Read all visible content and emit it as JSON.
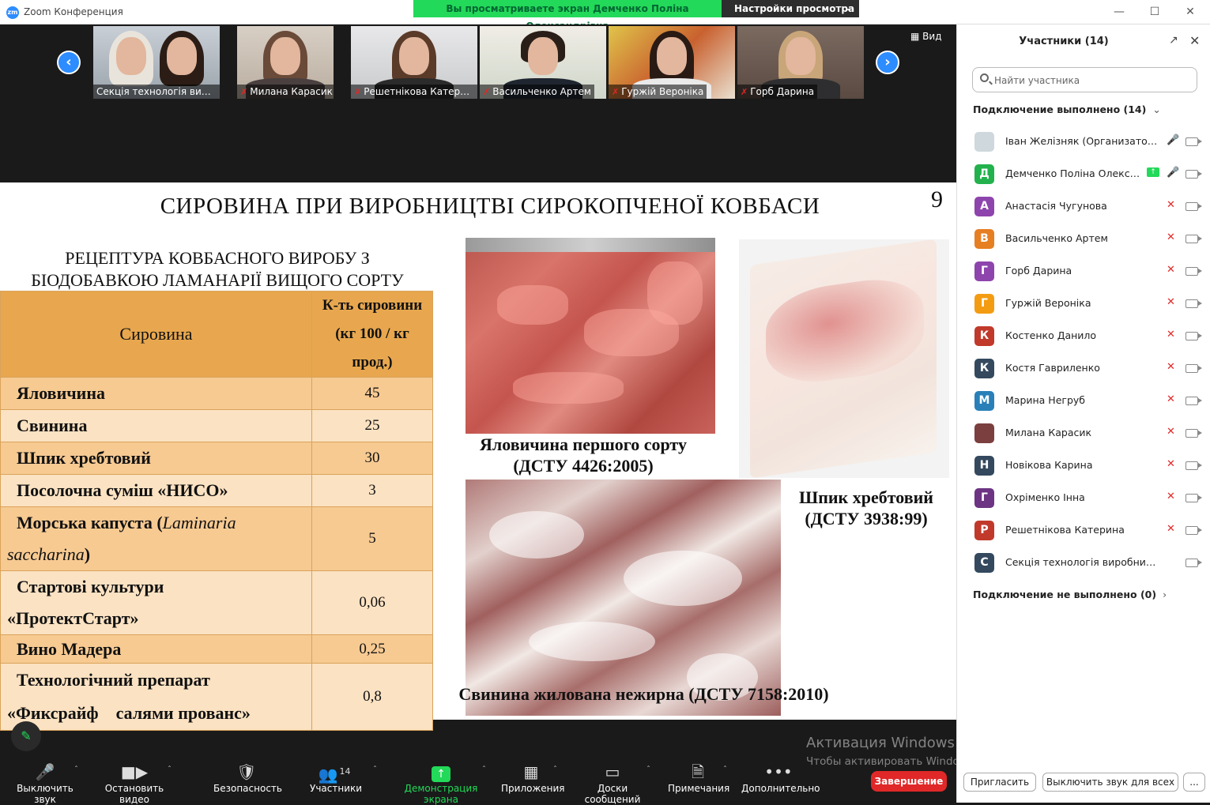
{
  "window": {
    "app_title": "Zoom Конференция",
    "logo_text": "zm",
    "share_banner": "Вы просматриваете экран Демченко Поліна Олександрівна",
    "view_settings": "Настройки просмотра"
  },
  "gallery": {
    "view_label": "Вид",
    "tiles": [
      {
        "name": "Секція технологія виро...",
        "muted": false
      },
      {
        "name": "Милана Карасик",
        "muted": true
      },
      {
        "name": "Решетнікова Катерина",
        "muted": true
      },
      {
        "name": "Васильченко Артем",
        "muted": true
      },
      {
        "name": "Гуржій Вероніка",
        "muted": true
      },
      {
        "name": "Горб Дарина",
        "muted": true
      }
    ]
  },
  "slide": {
    "title": "СИРОВИНА ПРИ ВИРОБНИЦТВІ СИРОКОПЧЕНОЇ КОВБАСИ",
    "number": "9",
    "recipe_title_1": "РЕЦЕПТУРА КОВБАСНОГО ВИРОБУ З",
    "recipe_title_2": "БІОДОБАВКОЮ ЛАМАНАРІЇ ВИЩОГО СОРТУ",
    "table": {
      "col_material": "Сировина",
      "col_qty_1": "К-ть сировини",
      "col_qty_2": "(кг 100 / кг",
      "col_qty_3": "прод.)",
      "rows": [
        {
          "name": "Яловичина",
          "value": "45"
        },
        {
          "name": "Свинина",
          "value": "25"
        },
        {
          "name": "Шпик хребтовий",
          "value": "30"
        },
        {
          "name": "Посолочна суміш «НИСО»",
          "value": "3"
        },
        {
          "name_1": "Морська капуста (",
          "name_lat_1": "Laminaria",
          "name_lat_2": "saccharina",
          "name_2": ")",
          "value": "5"
        },
        {
          "name_1": "Стартові культури",
          "name_2": "«ПротектСтарт»",
          "value": "0,06"
        },
        {
          "name": "Вино Мадера",
          "value": "0,25"
        },
        {
          "name_1": "Технологічний препарат",
          "name_2": "«Фиксрайф    салями прованс»",
          "value": "0,8"
        }
      ]
    },
    "caption_beef_1": "Яловичина першого сорту",
    "caption_beef_2": "(ДСТУ 4426:2005)",
    "caption_fat_1": "Шпик хребтовий",
    "caption_fat_2": "(ДСТУ 3938:99)",
    "caption_pork": "Свинина жилована нежирна (ДСТУ 7158:2010)"
  },
  "watermark": {
    "title": "Активация Windows",
    "subtitle": "Чтобы активировать Windows, перейдите в раздел \"Параметры\"."
  },
  "toolbar": {
    "mute": "Выключить звук",
    "stop_video": "Остановить видео",
    "security": "Безопасность",
    "participants": "Участники",
    "participants_count": "14",
    "share_screen": "Демонстрация экрана",
    "apps": "Приложения",
    "whiteboards": "Доски сообщений",
    "notes": "Примечания",
    "more": "Дополнительно",
    "end": "Завершение"
  },
  "panel": {
    "title": "Участники (14)",
    "search_placeholder": "Найти участника",
    "connected_label": "Подключение выполнено (14)",
    "not_connected_label": "Подключение не выполнено (0)",
    "participants": [
      {
        "initial": "",
        "name": "Іван Желізняк (Организатор, я)",
        "color": "#cfd8dc",
        "mic": "on",
        "sharing": false
      },
      {
        "initial": "Д",
        "name": "Демченко Поліна  Олексан...",
        "color": "#23b14d",
        "mic": "on",
        "sharing": true
      },
      {
        "initial": "А",
        "name": "Анастасія Чугунова",
        "color": "#8e44ad",
        "mic": "off",
        "sharing": false
      },
      {
        "initial": "В",
        "name": "Васильченко Артем",
        "color": "#e67e22",
        "mic": "off",
        "sharing": false
      },
      {
        "initial": "Г",
        "name": "Горб Дарина",
        "color": "#8e44ad",
        "mic": "off",
        "sharing": false
      },
      {
        "initial": "Г",
        "name": "Гуржій Вероніка",
        "color": "#f39c12",
        "mic": "off",
        "sharing": false
      },
      {
        "initial": "К",
        "name": "Костенко Данило",
        "color": "#c0392b",
        "mic": "off",
        "sharing": false
      },
      {
        "initial": "К",
        "name": "Костя  Гавриленко",
        "color": "#34495e",
        "mic": "off",
        "sharing": false
      },
      {
        "initial": "М",
        "name": "Марина Негруб",
        "color": "#2980b9",
        "mic": "off",
        "sharing": false
      },
      {
        "initial": "",
        "name": "Милана Карасик",
        "color": "#7b3f3f",
        "mic": "off",
        "sharing": false
      },
      {
        "initial": "Н",
        "name": "Новікова Карина",
        "color": "#34495e",
        "mic": "off",
        "sharing": false
      },
      {
        "initial": "Г",
        "name": "Охріменко Інна",
        "color": "#6c3483",
        "mic": "off",
        "sharing": false
      },
      {
        "initial": "Р",
        "name": "Решетнікова Катерина",
        "color": "#c0392b",
        "mic": "off",
        "sharing": false
      },
      {
        "initial": "С",
        "name": "Секція технологія виробництва про...",
        "color": "#34495e",
        "mic": "none",
        "sharing": false
      }
    ],
    "invite": "Пригласить",
    "mute_all": "Выключить звук для всех",
    "more": "..."
  }
}
